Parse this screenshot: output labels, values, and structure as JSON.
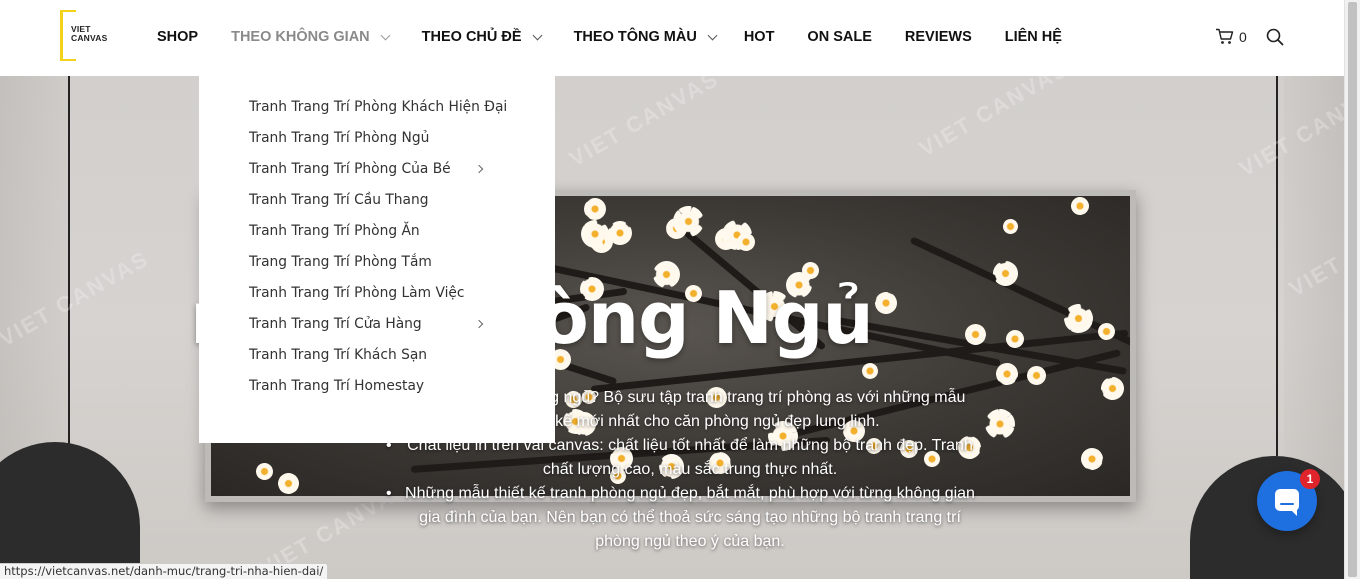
{
  "logo": {
    "line1": "VIET",
    "line2": "CANVAS"
  },
  "nav": {
    "items": [
      {
        "label": "SHOP",
        "dropdown": false
      },
      {
        "label": "THEO KHÔNG GIAN",
        "dropdown": true,
        "active": true
      },
      {
        "label": "THEO CHỦ ĐỀ",
        "dropdown": true
      },
      {
        "label": "THEO TÔNG MÀU",
        "dropdown": true
      },
      {
        "label": "HOT",
        "dropdown": false
      },
      {
        "label": "ON SALE",
        "dropdown": false
      },
      {
        "label": "REVIEWS",
        "dropdown": false
      },
      {
        "label": "LIÊN HỆ",
        "dropdown": false
      }
    ]
  },
  "cart": {
    "count": "0",
    "icon": "cart-icon"
  },
  "search": {
    "icon": "search-icon"
  },
  "dropdown": {
    "items": [
      {
        "label": "Tranh Trang Trí Phòng Khách Hiện Đại",
        "submenu": false
      },
      {
        "label": "Tranh Trang Trí Phòng Ngủ",
        "submenu": false
      },
      {
        "label": "Tranh Trang Trí Phòng Của Bé",
        "submenu": true
      },
      {
        "label": "Tranh Trang Trí Cầu Thang",
        "submenu": false
      },
      {
        "label": "Tranh Trang Trí Phòng Ăn",
        "submenu": false
      },
      {
        "label": "Trang Trang Trí Phòng Tắm",
        "submenu": false
      },
      {
        "label": "Tranh Trang Trí Phòng Làm Việc",
        "submenu": false
      },
      {
        "label": "Tranh Trang Trí Cửa Hàng",
        "submenu": true
      },
      {
        "label": "Tranh Trang Trí Khách Sạn",
        "submenu": false
      },
      {
        "label": "Tranh Trang Trí Homestay",
        "submenu": false
      }
    ]
  },
  "hero": {
    "title": "ng Trí Phòng Ngủ",
    "intro": "treo tường phòng ngủ? Bộ sưu tập tranh trang trí phòng as với những mẫu thiết kế mới nhất cho căn phòng ngủ đẹp lung linh.",
    "bullets": [
      "Chất liệu in trên vải canvas: chất liệu tốt nhất để làm những bộ tranh đẹp. Tranh chất lượng cao, màu sắc trung thực nhất.",
      "Những mẫu thiết kế tranh phòng ngủ đẹp, bắt mắt, phù hợp với từng không gian gia đình của bạn. Nên bạn có thể thoả sức sáng tạo những bộ tranh trang trí phòng ngủ theo ý của bạn."
    ],
    "watermark": "VIET CANVAS"
  },
  "chat": {
    "badge": "1"
  },
  "status_link": "https://vietcanvas.net/danh-muc/trang-tri-nha-hien-dai/",
  "colors": {
    "logo_accent": "#f2d21b",
    "chat_blue": "#1e6fe0",
    "badge_red": "#e0242c"
  }
}
